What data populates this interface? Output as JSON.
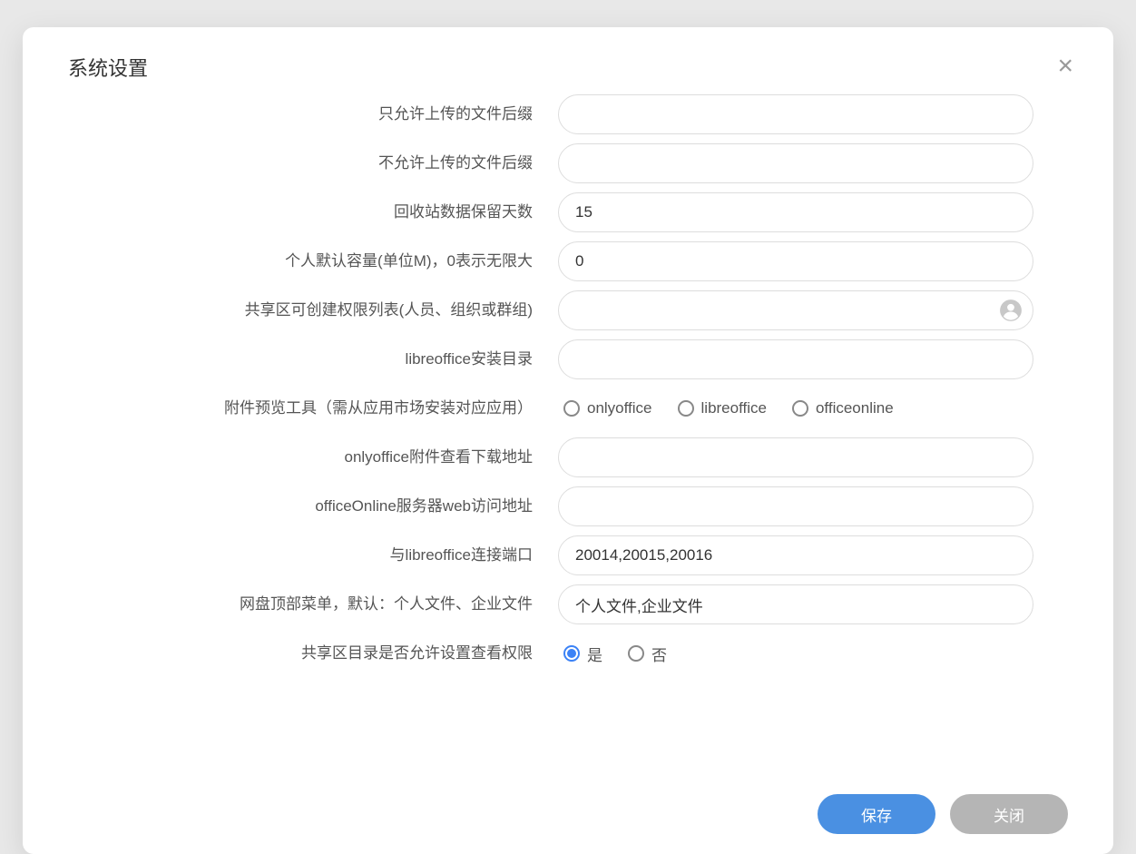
{
  "modal": {
    "title": "系统设置",
    "fields": {
      "allowed_suffix": {
        "label": "只允许上传的文件后缀",
        "value": ""
      },
      "disallowed_suffix": {
        "label": "不允许上传的文件后缀",
        "value": ""
      },
      "recycle_days": {
        "label": "回收站数据保留天数",
        "value": "15"
      },
      "personal_capacity": {
        "label": "个人默认容量(单位M)，0表示无限大",
        "value": "0"
      },
      "share_permission_list": {
        "label": "共享区可创建权限列表(人员、组织或群组)",
        "value": ""
      },
      "libreoffice_path": {
        "label": "libreoffice安装目录",
        "value": ""
      },
      "preview_tool": {
        "label": "附件预览工具（需从应用市场安装对应应用）",
        "options": {
          "onlyoffice": "onlyoffice",
          "libreoffice": "libreoffice",
          "officeonline": "officeonline"
        },
        "selected": ""
      },
      "onlyoffice_download_url": {
        "label": "onlyoffice附件查看下载地址",
        "value": ""
      },
      "officeonline_web_url": {
        "label": "officeOnline服务器web访问地址",
        "value": ""
      },
      "libreoffice_port": {
        "label": "与libreoffice连接端口",
        "value": "20014,20015,20016"
      },
      "top_menu": {
        "label": "网盘顶部菜单，默认：个人文件、企业文件",
        "value": "个人文件,企业文件"
      },
      "share_view_permission": {
        "label": "共享区目录是否允许设置查看权限",
        "options": {
          "yes": "是",
          "no": "否"
        },
        "selected": "yes"
      }
    },
    "buttons": {
      "save": "保存",
      "close": "关闭"
    }
  }
}
